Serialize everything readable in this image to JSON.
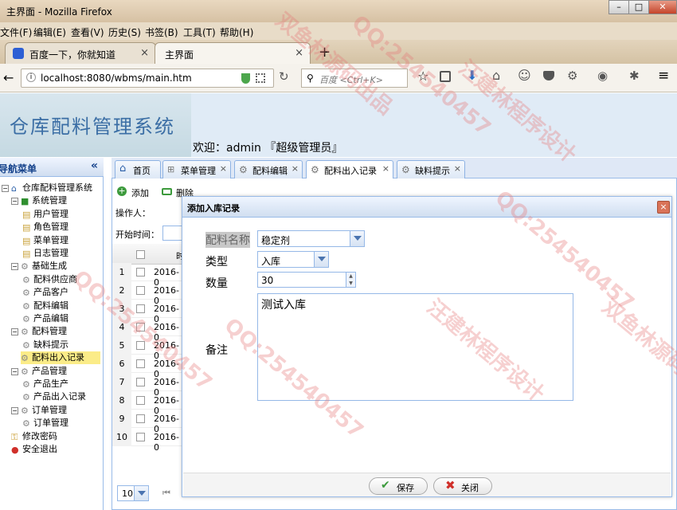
{
  "browser": {
    "window_title": "主界面 - Mozilla Firefox",
    "menu": [
      "文件(F)",
      "编辑(E)",
      "查看(V)",
      "历史(S)",
      "书签(B)",
      "工具(T)",
      "帮助(H)"
    ],
    "tabs": [
      {
        "label": "百度一下，你就知道"
      },
      {
        "label": "主界面"
      }
    ],
    "new_tab": "+",
    "url": "localhost:8080/wbms/main.htm",
    "search_placeholder": "百度 <Ctrl+K>"
  },
  "app": {
    "title": "仓库配料管理系统",
    "welcome": "欢迎：admin 『超级管理员』"
  },
  "sidebar": {
    "header": "导航菜单",
    "collapse": "«",
    "tree": [
      {
        "label": "仓库配料管理系统",
        "level": 0,
        "type": "root"
      },
      {
        "label": "系统管理",
        "level": 1,
        "type": "folder"
      },
      {
        "label": "用户管理",
        "level": 2,
        "type": "doc"
      },
      {
        "label": "角色管理",
        "level": 2,
        "type": "doc"
      },
      {
        "label": "菜单管理",
        "level": 2,
        "type": "doc"
      },
      {
        "label": "日志管理",
        "level": 2,
        "type": "doc"
      },
      {
        "label": "基础生成",
        "level": 1,
        "type": "gear"
      },
      {
        "label": "配料供应商",
        "level": 2,
        "type": "gear"
      },
      {
        "label": "产品客户",
        "level": 2,
        "type": "gear"
      },
      {
        "label": "配料编辑",
        "level": 2,
        "type": "gear"
      },
      {
        "label": "产品编辑",
        "level": 2,
        "type": "gear"
      },
      {
        "label": "配料管理",
        "level": 1,
        "type": "gear"
      },
      {
        "label": "缺料提示",
        "level": 2,
        "type": "gear"
      },
      {
        "label": "配料出入记录",
        "level": 2,
        "type": "gear",
        "selected": true
      },
      {
        "label": "产品管理",
        "level": 1,
        "type": "gear"
      },
      {
        "label": "产品生产",
        "level": 2,
        "type": "gear"
      },
      {
        "label": "产品出入记录",
        "level": 2,
        "type": "gear"
      },
      {
        "label": "订单管理",
        "level": 1,
        "type": "gear"
      },
      {
        "label": "订单管理",
        "level": 2,
        "type": "gear"
      },
      {
        "label": "修改密码",
        "level": 1,
        "type": "key"
      },
      {
        "label": "安全退出",
        "level": 1,
        "type": "exit"
      }
    ]
  },
  "content_tabs": [
    {
      "label": "首页",
      "closable": false
    },
    {
      "label": "菜单管理",
      "closable": true
    },
    {
      "label": "配料编辑",
      "closable": true
    },
    {
      "label": "配料出入记录",
      "closable": true,
      "active": true
    },
    {
      "label": "缺料提示",
      "closable": true
    }
  ],
  "toolbar": {
    "add": "添加",
    "delete": "删除"
  },
  "filters": {
    "operator": "操作人：",
    "start_time": "开始时间："
  },
  "grid": {
    "header_col": "时",
    "rows": [
      {
        "n": "1",
        "d": "2016-0"
      },
      {
        "n": "2",
        "d": "2016-0"
      },
      {
        "n": "3",
        "d": "2016-0"
      },
      {
        "n": "4",
        "d": "2016-0"
      },
      {
        "n": "5",
        "d": "2016-0"
      },
      {
        "n": "6",
        "d": "2016-0"
      },
      {
        "n": "7",
        "d": "2016-0"
      },
      {
        "n": "8",
        "d": "2016-0"
      },
      {
        "n": "9",
        "d": "2016-0"
      },
      {
        "n": "10",
        "d": "2016-0"
      }
    ],
    "page_size": "10"
  },
  "dialog": {
    "title": "添加入库记录",
    "close": "×",
    "fields": {
      "material_label": "配料名称",
      "material_value": "稳定剂",
      "type_label": "类型",
      "type_value": "入库",
      "qty_label": "数量",
      "qty_value": "30",
      "remark_label": "备注",
      "remark_value": "测试入库"
    },
    "save": "保存",
    "close_btn": "关闭"
  },
  "watermarks": [
    "双鱼林源码出品",
    "QQ:254540457",
    "汪建林程序设计",
    "QQ:254540457",
    "双鱼林源码出品",
    "QQ:254540457",
    "汪建林程序设计",
    "QQ:254540457"
  ],
  "colors": {
    "accent": "#99bbe8",
    "title": "#3b6ea5",
    "selected": "#fbec88"
  }
}
